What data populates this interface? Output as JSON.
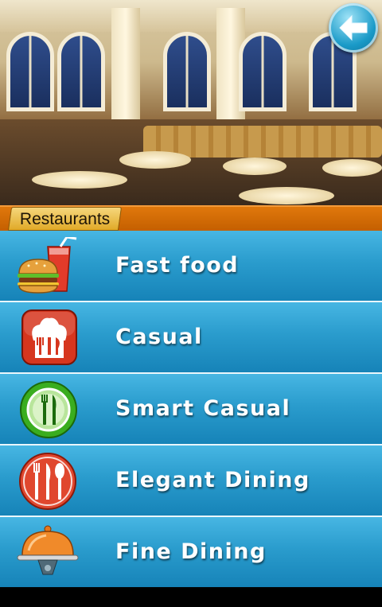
{
  "header": {
    "title": "Restaurants",
    "accent_color": "#d46a06"
  },
  "hero": {
    "image": "restaurant-interior-photo"
  },
  "back_button": {
    "icon": "arrow-left-icon"
  },
  "menu": {
    "items": [
      {
        "label": "Fast food",
        "icon": "burger-drink-icon"
      },
      {
        "label": "Casual",
        "icon": "chef-hat-cutlery-icon"
      },
      {
        "label": "Smart Casual",
        "icon": "plate-fork-knife-icon"
      },
      {
        "label": "Elegant Dining",
        "icon": "fork-knife-spoon-icon"
      },
      {
        "label": "Fine Dining",
        "icon": "cloche-icon"
      }
    ],
    "item_color": "#2a9ccd"
  }
}
